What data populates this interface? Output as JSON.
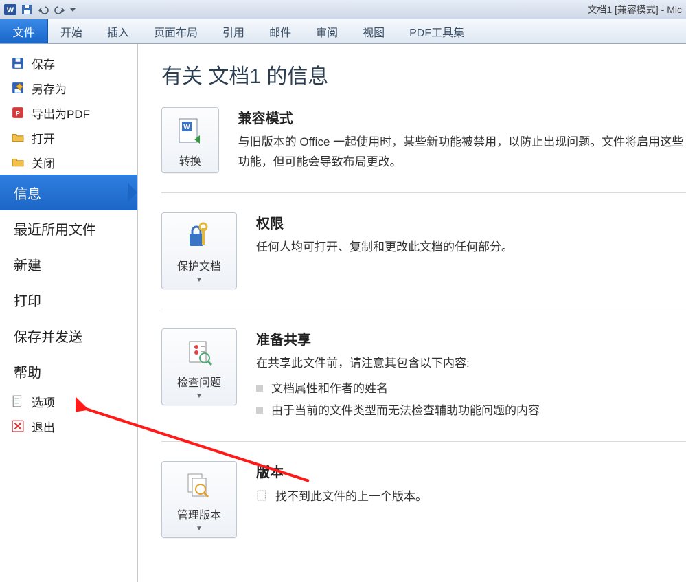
{
  "window": {
    "title": "文档1 [兼容模式] - Mic"
  },
  "ribbon": {
    "file": "文件",
    "tabs": [
      "开始",
      "插入",
      "页面布局",
      "引用",
      "邮件",
      "审阅",
      "视图",
      "PDF工具集"
    ]
  },
  "sidebar": {
    "save": "保存",
    "save_as": "另存为",
    "export_pdf": "导出为PDF",
    "open": "打开",
    "close": "关闭",
    "info": "信息",
    "recent": "最近所用文件",
    "new": "新建",
    "print": "打印",
    "save_send": "保存并发送",
    "help": "帮助",
    "options": "选项",
    "exit": "退出"
  },
  "main": {
    "title": "有关 文档1 的信息",
    "s1": {
      "btn": "转换",
      "h": "兼容模式",
      "p": "与旧版本的 Office 一起使用时，某些新功能被禁用，以防止出现问题。文件将启用这些功能，但可能会导致布局更改。"
    },
    "s2": {
      "btn": "保护文档",
      "h": "权限",
      "p": "任何人均可打开、复制和更改此文档的任何部分。"
    },
    "s3": {
      "btn": "检查问题",
      "h": "准备共享",
      "p": "在共享此文件前，请注意其包含以下内容:",
      "b1": "文档属性和作者的姓名",
      "b2": "由于当前的文件类型而无法检查辅助功能问题的内容"
    },
    "s4": {
      "btn": "管理版本",
      "h": "版本",
      "p": "找不到此文件的上一个版本。"
    }
  }
}
